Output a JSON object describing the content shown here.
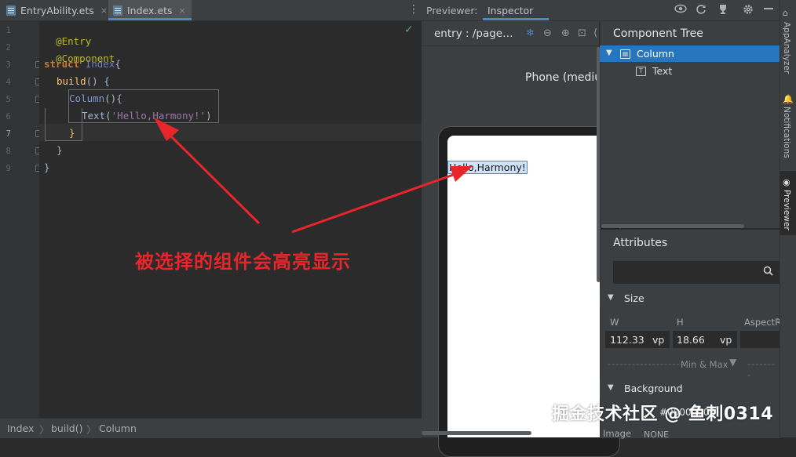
{
  "editor": {
    "tabs": [
      {
        "label": "EntryAbility.ets",
        "close": "×"
      },
      {
        "label": "Index.ets",
        "close": "×"
      }
    ],
    "menu_glyph": "⋮",
    "line_numbers": [
      "1",
      "2",
      "3",
      "4",
      "5",
      "6",
      "7",
      "8",
      "9"
    ],
    "lines": {
      "l1": "@Entry",
      "l2": "@Component",
      "l3_kw": "struct",
      "l3_name": "Index",
      "l3_brace": "{",
      "l4_fn": "build",
      "l4_rest": "() {",
      "l5_fn": "Column",
      "l5_rest": "(){",
      "l6_fn": "Text",
      "l6_open": "(",
      "l6_str": "'Hello,Harmony!'",
      "l6_close": ")",
      "l7": "}",
      "l8": "}",
      "l9": "}"
    },
    "check_glyph": "✓"
  },
  "annotation": {
    "text": "被选择的组件会高亮显示",
    "color": "#e8252b"
  },
  "breadcrumb": {
    "items": [
      "Index",
      "build()",
      "Column"
    ],
    "separator": "〉"
  },
  "previewer": {
    "label": "Previewer:",
    "tab": "Inspector",
    "toolbar_icons": [
      "eye-icon",
      "refresh-icon",
      "trophy-icon",
      "gear-icon",
      "minimize-icon"
    ],
    "entry": "entry : /page…",
    "device_label": "Phone (mediu",
    "hello_text": "Hello,Harmony!"
  },
  "component_tree": {
    "title": "Component Tree",
    "nodes": [
      {
        "label": "Column",
        "selected": true
      },
      {
        "label": "Text",
        "selected": false
      }
    ]
  },
  "attributes": {
    "title": "Attributes",
    "size_section": "Size",
    "w_label": "W",
    "h_label": "H",
    "aspect_label": "AspectR",
    "w_value": "112.33",
    "w_unit": "vp",
    "h_value": "18.66",
    "h_unit": "vp",
    "minmax": "Min & Max",
    "background_section": "Background",
    "bg_value": "#00000000",
    "image_label": "Image",
    "image_value": "NONE"
  },
  "right_stripe": {
    "items": [
      "AppAnalyzer",
      "Notifications",
      "Previewer"
    ]
  },
  "watermark": "掘金技术社区 @ 鱼刺0314",
  "colors": {
    "accent": "#4a88c7",
    "selection": "#2675bf",
    "background": "#2b2b2b",
    "panel": "#3c3f41"
  }
}
